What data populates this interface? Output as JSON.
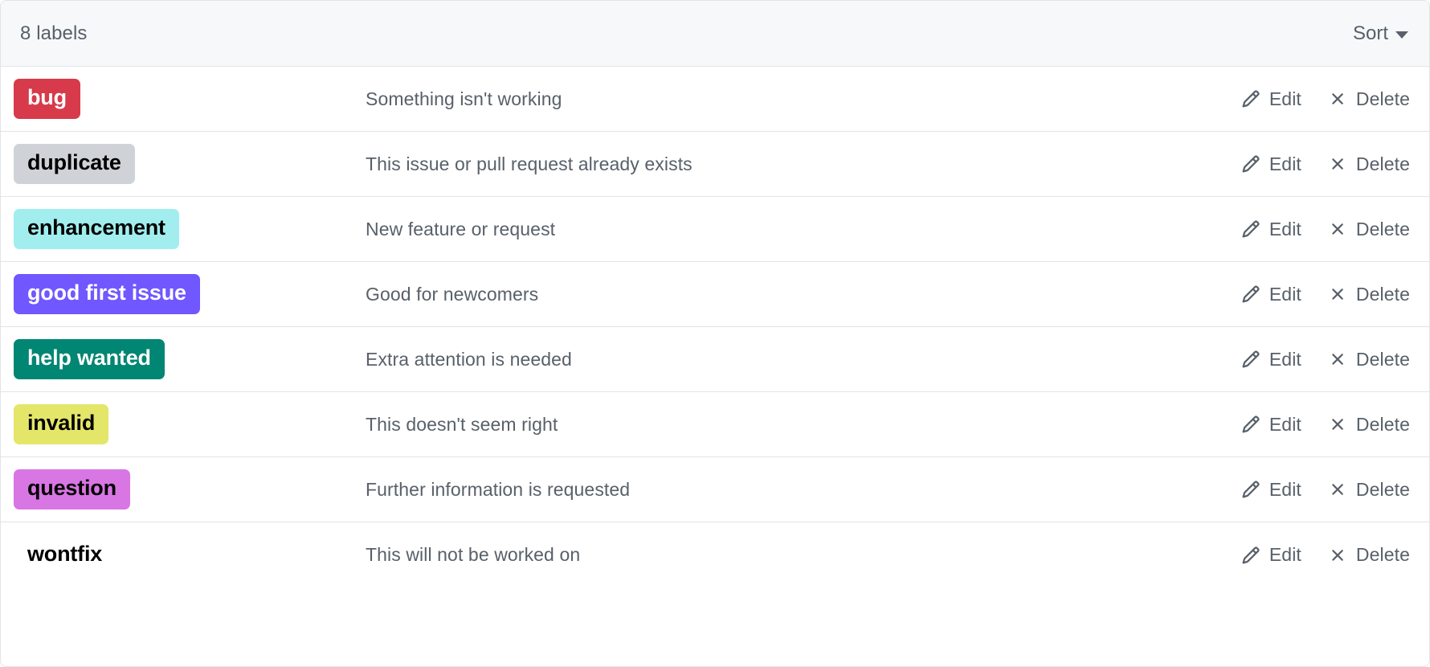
{
  "header": {
    "count_text": "8 labels",
    "sort_label": "Sort",
    "caret_icon": "chevron-down-icon"
  },
  "actions": {
    "edit_label": "Edit",
    "delete_label": "Delete",
    "edit_icon": "pencil-icon",
    "delete_icon": "close-x-icon"
  },
  "colors": {
    "header_bg": "#f6f8fa",
    "border": "#e1e4e8",
    "muted_text": "#586069",
    "page_bg": "#ffffff"
  },
  "labels": [
    {
      "name": "bug",
      "description": "Something isn't working",
      "bg": "#d73a4a",
      "fg": "#ffffff"
    },
    {
      "name": "duplicate",
      "description": "This issue or pull request already exists",
      "bg": "#cfd3d7",
      "fg": "#000000"
    },
    {
      "name": "enhancement",
      "description": "New feature or request",
      "bg": "#a2eeef",
      "fg": "#000000"
    },
    {
      "name": "good first issue",
      "description": "Good for newcomers",
      "bg": "#7057ff",
      "fg": "#ffffff"
    },
    {
      "name": "help wanted",
      "description": "Extra attention is needed",
      "bg": "#008672",
      "fg": "#ffffff"
    },
    {
      "name": "invalid",
      "description": "This doesn't seem right",
      "bg": "#e4e669",
      "fg": "#000000"
    },
    {
      "name": "question",
      "description": "Further information is requested",
      "bg": "#d876e3",
      "fg": "#000000"
    },
    {
      "name": "wontfix",
      "description": "This will not be worked on",
      "bg": "#ffffff",
      "fg": "#000000"
    }
  ]
}
